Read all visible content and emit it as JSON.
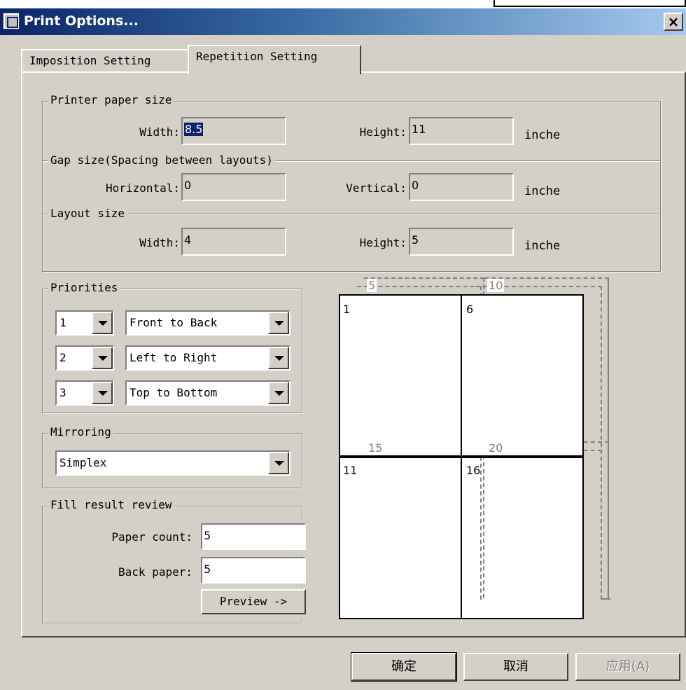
{
  "window": {
    "title": "Print Options..."
  },
  "tabs": [
    {
      "label": "Imposition Setting"
    },
    {
      "label": "Repetition Setting"
    }
  ],
  "printer_paper_size": {
    "legend": "Printer paper size",
    "width_label": "Width:",
    "width_value": "8.5",
    "height_label": "Height:",
    "height_value": "11",
    "unit": "inche"
  },
  "gap_size": {
    "legend": "Gap size(Spacing between layouts)",
    "horizontal_label": "Horizontal:",
    "horizontal_value": "0",
    "vertical_label": "Vertical:",
    "vertical_value": "0",
    "unit": "inche"
  },
  "layout_size": {
    "legend": "Layout size",
    "width_label": "Width:",
    "width_value": "4",
    "height_label": "Height:",
    "height_value": "5",
    "unit": "inche"
  },
  "priorities": {
    "legend": "Priorities",
    "rows": [
      {
        "number": "1",
        "direction": "Front to Back"
      },
      {
        "number": "2",
        "direction": "Left to Right"
      },
      {
        "number": "3",
        "direction": "Top to Bottom"
      }
    ]
  },
  "mirroring": {
    "legend": "Mirroring",
    "value": "Simplex"
  },
  "fill_result": {
    "legend": "Fill result review",
    "paper_count_label": "Paper count:",
    "paper_count_value": "5",
    "back_paper_label": "Back paper:",
    "back_paper_value": "5",
    "preview_label": "Preview ->"
  },
  "preview": {
    "pages": [
      "1",
      "6",
      "11",
      "16"
    ],
    "back_pages": [
      "5",
      "10",
      "15",
      "20"
    ]
  },
  "footer": {
    "ok_label": "确定",
    "cancel_label": "取消",
    "apply_label": "应用(A)"
  },
  "colors": {
    "title_start": "#0a246a",
    "title_end": "#a6caf0",
    "face": "#d4d0c8",
    "selection": "#0a246a"
  },
  "icons": {
    "title": "print-options-icon",
    "close": "close-icon",
    "dropdown": "chevron-down-icon"
  }
}
